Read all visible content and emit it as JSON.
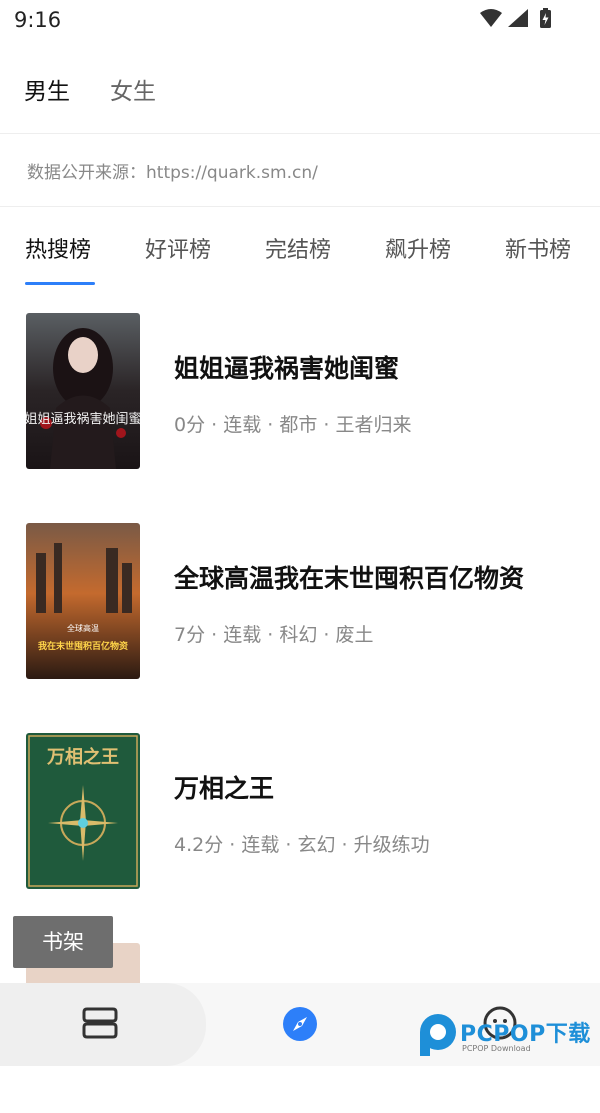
{
  "status_bar": {
    "time": "9:16"
  },
  "gender_tabs": [
    {
      "label": "男生",
      "active": true
    },
    {
      "label": "女生",
      "active": false
    }
  ],
  "source_note": "数据公开来源：https://quark.sm.cn/",
  "rank_tabs": [
    {
      "label": "热搜榜",
      "active": true
    },
    {
      "label": "好评榜",
      "active": false
    },
    {
      "label": "完结榜",
      "active": false
    },
    {
      "label": "飙升榜",
      "active": false
    },
    {
      "label": "新书榜",
      "active": false
    }
  ],
  "books": [
    {
      "title": "姐姐逼我祸害她闺蜜",
      "meta": "0分 · 连载 · 都市 · 王者归来",
      "cover_text": "姐姐逼我祸害她闺蜜"
    },
    {
      "title": "全球高温我在末世囤积百亿物资",
      "meta": "7分 · 连载 · 科幻 · 废土",
      "cover_text": "我在末世囤积百亿物资",
      "cover_top_text": "全球高温"
    },
    {
      "title": "万相之王",
      "meta": "4.2分 · 连载 · 玄幻 · 升级练功",
      "cover_text": "万相之王"
    }
  ],
  "shelf_button": "书架",
  "watermark": {
    "text": "PCPOP下载",
    "sub": "PCPOP Download"
  },
  "colors": {
    "accent": "#2d7ff9",
    "watermark": "#1e8fd8"
  },
  "icons": [
    "wifi-icon",
    "signal-icon",
    "battery-icon",
    "bookshelf-icon",
    "discover-compass-icon",
    "profile-icon"
  ]
}
